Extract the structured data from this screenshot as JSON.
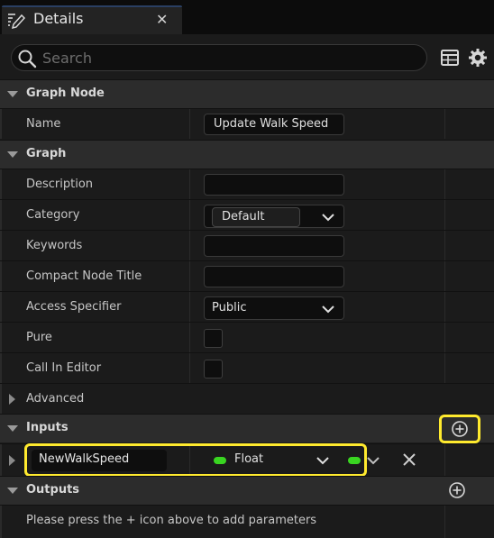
{
  "tab": {
    "title": "Details",
    "close_symbol": "✕"
  },
  "search": {
    "placeholder": "Search",
    "value": ""
  },
  "sections": {
    "graph_node": {
      "label": "Graph Node",
      "name_label": "Name",
      "name_value": "Update Walk Speed"
    },
    "graph": {
      "label": "Graph",
      "description_label": "Description",
      "description_value": "",
      "category_label": "Category",
      "category_value": "Default",
      "keywords_label": "Keywords",
      "keywords_value": "",
      "compact_title_label": "Compact Node Title",
      "compact_title_value": "",
      "access_label": "Access Specifier",
      "access_value": "Public",
      "pure_label": "Pure",
      "pure_checked": false,
      "call_in_editor_label": "Call In Editor",
      "call_in_editor_checked": false
    },
    "advanced": {
      "label": "Advanced"
    },
    "inputs": {
      "label": "Inputs",
      "params": [
        {
          "name": "NewWalkSpeed",
          "type": "Float",
          "pin_color": "#39d521"
        }
      ]
    },
    "outputs": {
      "label": "Outputs",
      "hint": "Please press the + icon above to add parameters"
    }
  },
  "colors": {
    "highlight": "#ffea2e",
    "float_pin": "#39d521"
  }
}
